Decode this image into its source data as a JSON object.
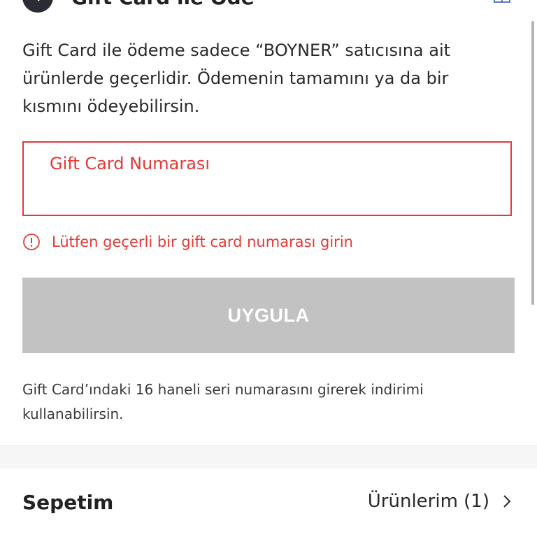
{
  "header": {
    "title": "Gift Card ile Öde",
    "left_icon": "back-chevron-icon",
    "right_icon": "gift-icon"
  },
  "description": "Gift Card ile ödeme sadece “BOYNER” satıcısına ait ürünlerde geçerlidir. Ödemenin tamamını ya da bir kısmını ödeyebilirsin.",
  "gift_card_input": {
    "label": "Gift Card Numarası",
    "value": ""
  },
  "error": {
    "icon": "alert-circle-icon",
    "message": "Lütfen geçerli bir gift card numarası girin"
  },
  "apply_button": {
    "label": "UYGULA",
    "state": "disabled"
  },
  "hint": "Gift Card’ındaki 16 haneli seri numarasını girerek indirimi kullanabilirsin.",
  "cart": {
    "title": "Sepetim",
    "link_label": "Ürünlerim (1)",
    "link_icon": "chevron-right-icon"
  },
  "colors": {
    "error": "#e53935",
    "button_disabled": "#c2c2c2",
    "text": "#222222"
  }
}
